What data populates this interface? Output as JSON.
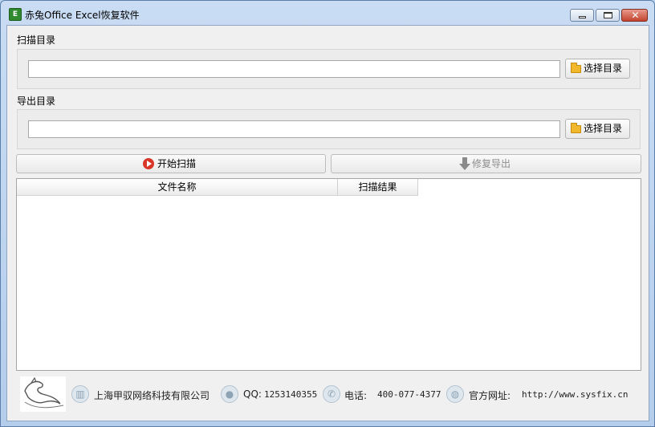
{
  "window": {
    "title": "赤兔Office Excel恢复软件",
    "app_icon_glyph": "E",
    "controls": {
      "close_glyph": "✕"
    }
  },
  "scan_dir": {
    "label": "扫描目录",
    "value": "",
    "choose_label": "选择目录"
  },
  "export_dir": {
    "label": "导出目录",
    "value": "",
    "choose_label": "选择目录"
  },
  "actions": {
    "start_label": "开始扫描",
    "export_label": "修复导出"
  },
  "results_table": {
    "columns": [
      "文件名称",
      "扫描结果"
    ],
    "rows": []
  },
  "footer": {
    "company": "上海甲驭网络科技有限公司",
    "qq_label": "QQ:",
    "qq_value": "1253140355",
    "phone_label": "电话:",
    "phone_value": "400-077-4377",
    "website_label": "官方网址:",
    "website_value": "http://www.sysfix.cn"
  },
  "colors": {
    "titlebar": "#c9dcf3",
    "close_button": "#c2442f",
    "start_icon": "#d9362a",
    "folder_icon": "#f2b82b",
    "disabled_text": "#8c8c8c"
  },
  "icons": {
    "app": "excel-recovery-app-icon",
    "folder": "folder-icon",
    "start": "play-circle-icon",
    "export": "down-arrow-icon",
    "company": "building-icon",
    "qq": "qq-penguin-icon",
    "phone": "phone-icon",
    "website": "globe-icon",
    "logo": "horse-logo"
  }
}
